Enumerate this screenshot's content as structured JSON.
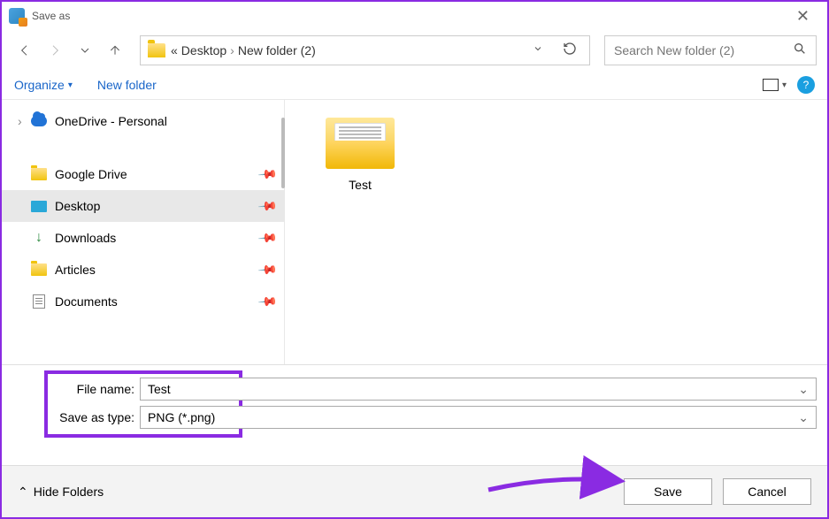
{
  "window": {
    "title": "Save as"
  },
  "breadcrumbs": {
    "prefix": "«",
    "items": [
      "Desktop",
      "New folder (2)"
    ]
  },
  "search": {
    "placeholder": "Search New folder (2)"
  },
  "toolbar": {
    "organize": "Organize",
    "new_folder": "New folder"
  },
  "tree": {
    "top": {
      "label": "OneDrive - Personal"
    },
    "items": [
      {
        "label": "Google Drive",
        "icon": "folder-yellow",
        "pinned": true
      },
      {
        "label": "Desktop",
        "icon": "desk-ico",
        "pinned": true,
        "selected": true
      },
      {
        "label": "Downloads",
        "icon": "down-ico",
        "pinned": true
      },
      {
        "label": "Articles",
        "icon": "folder-yellow",
        "pinned": true
      },
      {
        "label": "Documents",
        "icon": "doc-ico",
        "pinned": true
      }
    ]
  },
  "content": {
    "items": [
      {
        "label": "Test"
      }
    ]
  },
  "fields": {
    "filename_label": "File name:",
    "filename_value": "Test",
    "savetype_label": "Save as type:",
    "savetype_value": "PNG (*.png)"
  },
  "footer": {
    "hide_folders": "Hide Folders",
    "save": "Save",
    "cancel": "Cancel"
  }
}
